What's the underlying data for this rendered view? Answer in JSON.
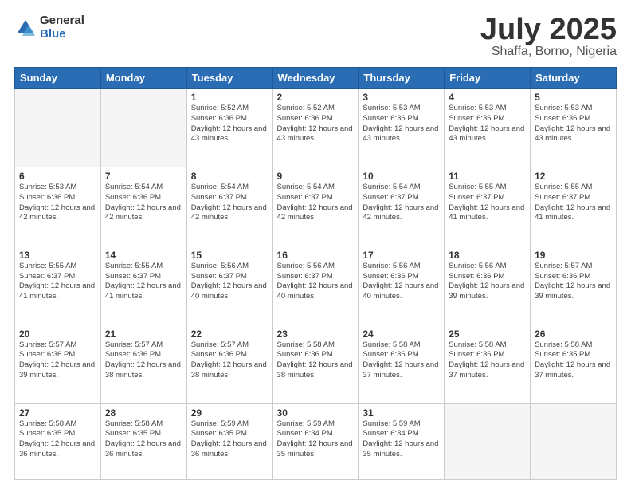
{
  "header": {
    "logo_general": "General",
    "logo_blue": "Blue",
    "title_month": "July 2025",
    "title_location": "Shaffa, Borno, Nigeria"
  },
  "days_of_week": [
    "Sunday",
    "Monday",
    "Tuesday",
    "Wednesday",
    "Thursday",
    "Friday",
    "Saturday"
  ],
  "weeks": [
    [
      {
        "day": "",
        "info": ""
      },
      {
        "day": "",
        "info": ""
      },
      {
        "day": "1",
        "info": "Sunrise: 5:52 AM\nSunset: 6:36 PM\nDaylight: 12 hours and 43 minutes."
      },
      {
        "day": "2",
        "info": "Sunrise: 5:52 AM\nSunset: 6:36 PM\nDaylight: 12 hours and 43 minutes."
      },
      {
        "day": "3",
        "info": "Sunrise: 5:53 AM\nSunset: 6:36 PM\nDaylight: 12 hours and 43 minutes."
      },
      {
        "day": "4",
        "info": "Sunrise: 5:53 AM\nSunset: 6:36 PM\nDaylight: 12 hours and 43 minutes."
      },
      {
        "day": "5",
        "info": "Sunrise: 5:53 AM\nSunset: 6:36 PM\nDaylight: 12 hours and 43 minutes."
      }
    ],
    [
      {
        "day": "6",
        "info": "Sunrise: 5:53 AM\nSunset: 6:36 PM\nDaylight: 12 hours and 42 minutes."
      },
      {
        "day": "7",
        "info": "Sunrise: 5:54 AM\nSunset: 6:36 PM\nDaylight: 12 hours and 42 minutes."
      },
      {
        "day": "8",
        "info": "Sunrise: 5:54 AM\nSunset: 6:37 PM\nDaylight: 12 hours and 42 minutes."
      },
      {
        "day": "9",
        "info": "Sunrise: 5:54 AM\nSunset: 6:37 PM\nDaylight: 12 hours and 42 minutes."
      },
      {
        "day": "10",
        "info": "Sunrise: 5:54 AM\nSunset: 6:37 PM\nDaylight: 12 hours and 42 minutes."
      },
      {
        "day": "11",
        "info": "Sunrise: 5:55 AM\nSunset: 6:37 PM\nDaylight: 12 hours and 41 minutes."
      },
      {
        "day": "12",
        "info": "Sunrise: 5:55 AM\nSunset: 6:37 PM\nDaylight: 12 hours and 41 minutes."
      }
    ],
    [
      {
        "day": "13",
        "info": "Sunrise: 5:55 AM\nSunset: 6:37 PM\nDaylight: 12 hours and 41 minutes."
      },
      {
        "day": "14",
        "info": "Sunrise: 5:55 AM\nSunset: 6:37 PM\nDaylight: 12 hours and 41 minutes."
      },
      {
        "day": "15",
        "info": "Sunrise: 5:56 AM\nSunset: 6:37 PM\nDaylight: 12 hours and 40 minutes."
      },
      {
        "day": "16",
        "info": "Sunrise: 5:56 AM\nSunset: 6:37 PM\nDaylight: 12 hours and 40 minutes."
      },
      {
        "day": "17",
        "info": "Sunrise: 5:56 AM\nSunset: 6:36 PM\nDaylight: 12 hours and 40 minutes."
      },
      {
        "day": "18",
        "info": "Sunrise: 5:56 AM\nSunset: 6:36 PM\nDaylight: 12 hours and 39 minutes."
      },
      {
        "day": "19",
        "info": "Sunrise: 5:57 AM\nSunset: 6:36 PM\nDaylight: 12 hours and 39 minutes."
      }
    ],
    [
      {
        "day": "20",
        "info": "Sunrise: 5:57 AM\nSunset: 6:36 PM\nDaylight: 12 hours and 39 minutes."
      },
      {
        "day": "21",
        "info": "Sunrise: 5:57 AM\nSunset: 6:36 PM\nDaylight: 12 hours and 38 minutes."
      },
      {
        "day": "22",
        "info": "Sunrise: 5:57 AM\nSunset: 6:36 PM\nDaylight: 12 hours and 38 minutes."
      },
      {
        "day": "23",
        "info": "Sunrise: 5:58 AM\nSunset: 6:36 PM\nDaylight: 12 hours and 38 minutes."
      },
      {
        "day": "24",
        "info": "Sunrise: 5:58 AM\nSunset: 6:36 PM\nDaylight: 12 hours and 37 minutes."
      },
      {
        "day": "25",
        "info": "Sunrise: 5:58 AM\nSunset: 6:36 PM\nDaylight: 12 hours and 37 minutes."
      },
      {
        "day": "26",
        "info": "Sunrise: 5:58 AM\nSunset: 6:35 PM\nDaylight: 12 hours and 37 minutes."
      }
    ],
    [
      {
        "day": "27",
        "info": "Sunrise: 5:58 AM\nSunset: 6:35 PM\nDaylight: 12 hours and 36 minutes."
      },
      {
        "day": "28",
        "info": "Sunrise: 5:58 AM\nSunset: 6:35 PM\nDaylight: 12 hours and 36 minutes."
      },
      {
        "day": "29",
        "info": "Sunrise: 5:59 AM\nSunset: 6:35 PM\nDaylight: 12 hours and 36 minutes."
      },
      {
        "day": "30",
        "info": "Sunrise: 5:59 AM\nSunset: 6:34 PM\nDaylight: 12 hours and 35 minutes."
      },
      {
        "day": "31",
        "info": "Sunrise: 5:59 AM\nSunset: 6:34 PM\nDaylight: 12 hours and 35 minutes."
      },
      {
        "day": "",
        "info": ""
      },
      {
        "day": "",
        "info": ""
      }
    ]
  ]
}
